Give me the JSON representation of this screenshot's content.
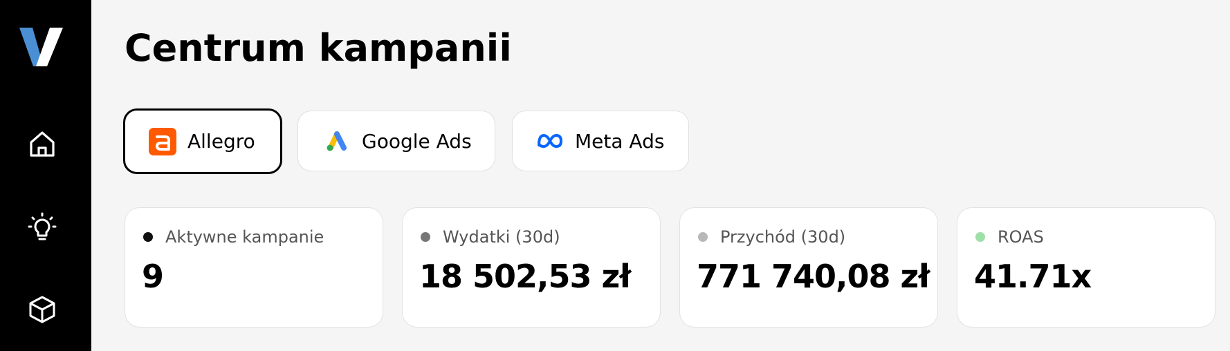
{
  "sidebar": {
    "logo_letter": "V",
    "items": [
      {
        "icon": "home-icon"
      },
      {
        "icon": "lightbulb-icon"
      },
      {
        "icon": "box-icon"
      }
    ]
  },
  "page": {
    "title": "Centrum kampanii"
  },
  "tabs": [
    {
      "label": "Allegro",
      "icon": "allegro-icon",
      "active": true,
      "color": "#ff5a00"
    },
    {
      "label": "Google Ads",
      "icon": "google-ads-icon",
      "active": false
    },
    {
      "label": "Meta Ads",
      "icon": "meta-icon",
      "active": false,
      "color": "#0866ff"
    }
  ],
  "stats": [
    {
      "label": "Aktywne kampanie",
      "value": "9",
      "dot_color": "#111111"
    },
    {
      "label": "Wydatki (30d)",
      "value": "18 502,53 zł",
      "dot_color": "#777777"
    },
    {
      "label": "Przychód (30d)",
      "value": "771 740,08 zł",
      "dot_color": "#b8b8b8"
    },
    {
      "label": "ROAS",
      "value": "41.71x",
      "dot_color": "#9ee0a8"
    }
  ]
}
